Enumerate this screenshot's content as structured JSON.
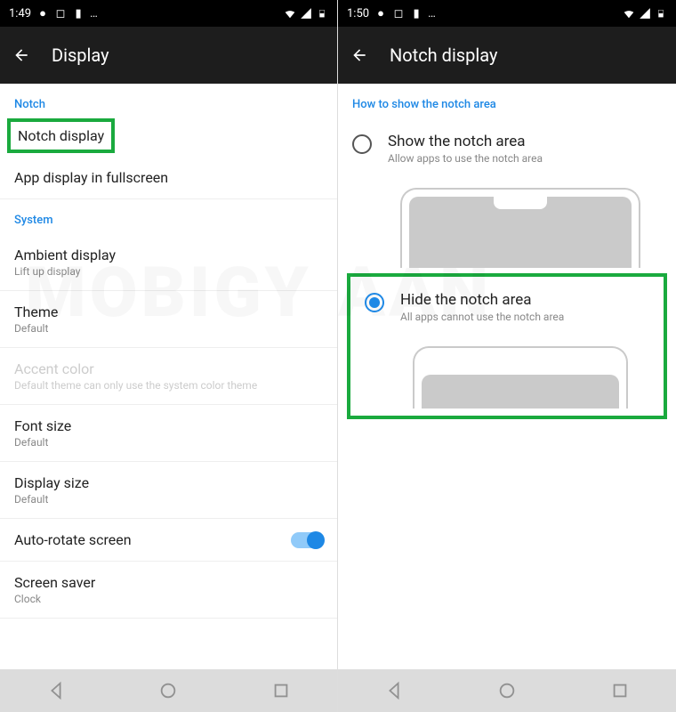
{
  "left": {
    "status": {
      "time": "1:49"
    },
    "header": {
      "title": "Display"
    },
    "sections": {
      "notch": {
        "label": "Notch"
      },
      "system": {
        "label": "System"
      }
    },
    "items": {
      "notch_display": "Notch display",
      "app_fullscreen": "App display in fullscreen",
      "ambient": {
        "title": "Ambient display",
        "sub": "Lift up display"
      },
      "theme": {
        "title": "Theme",
        "sub": "Default"
      },
      "accent": {
        "title": "Accent color",
        "sub": "Default theme can only use the system color theme"
      },
      "font": {
        "title": "Font size",
        "sub": "Default"
      },
      "display_size": {
        "title": "Display size",
        "sub": "Default"
      },
      "autorotate": {
        "title": "Auto-rotate screen"
      },
      "screensaver": {
        "title": "Screen saver",
        "sub": "Clock"
      }
    },
    "watermark": "MOBIGY"
  },
  "right": {
    "status": {
      "time": "1:50"
    },
    "header": {
      "title": "Notch display"
    },
    "section_label": "How to show the notch area",
    "options": {
      "show": {
        "title": "Show the notch area",
        "sub": "Allow apps to use the notch area"
      },
      "hide": {
        "title": "Hide the notch area",
        "sub": "All apps cannot use the notch area"
      }
    },
    "watermark": "AAN"
  },
  "colors": {
    "highlight": "#1aaa3e",
    "accent_blue": "#1e88e5"
  }
}
